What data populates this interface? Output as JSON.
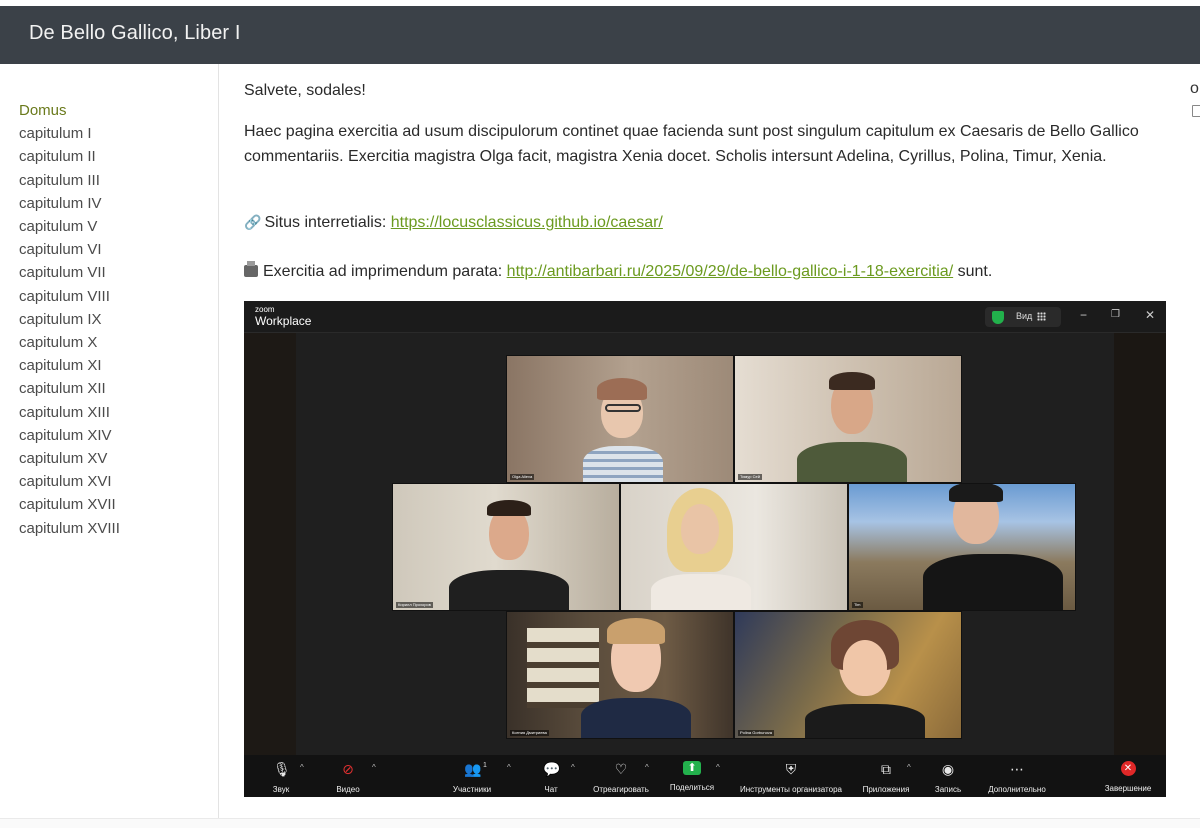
{
  "header": {
    "title": "De Bello Gallico, Liber I"
  },
  "sidebar": {
    "items": [
      {
        "label": "Domus"
      },
      {
        "label": "capitulum I"
      },
      {
        "label": "capitulum II"
      },
      {
        "label": "capitulum III"
      },
      {
        "label": "capitulum IV"
      },
      {
        "label": "capitulum V"
      },
      {
        "label": "capitulum VI"
      },
      {
        "label": "capitulum VII"
      },
      {
        "label": "capitulum VIII"
      },
      {
        "label": "capitulum IX"
      },
      {
        "label": "capitulum X"
      },
      {
        "label": "capitulum XI"
      },
      {
        "label": "capitulum XII"
      },
      {
        "label": "capitulum XIII"
      },
      {
        "label": "capitulum XIV"
      },
      {
        "label": "capitulum XV"
      },
      {
        "label": "capitulum XVI"
      },
      {
        "label": "capitulum XVII"
      },
      {
        "label": "capitulum XVIII"
      }
    ],
    "active_index": 0
  },
  "main": {
    "greeting": "Salvete, sodales!",
    "intro": "Haec pagina exercitia ad usum discipulorum continet quae facienda sunt post singulum capitulum ex Caesaris de Bello Gallico commentariis. Exercitia magistra Olga facit, magistra Xenia docet. Scholis intersunt Adelina, Cyrillus, Polina, Timur, Xenia.",
    "site_label": "Situs interretialis:",
    "site_url": "https://locusclassicus.github.io/caesar/",
    "print_label": "Exercitia ad imprimendum parata:",
    "print_url": "http://antibarbari.ru/2025/09/29/de-bello-gallico-i-1-18-exercitia/",
    "print_suffix": "sunt.",
    "right_edge_text": "o"
  },
  "zoom": {
    "logo_top": "zoom",
    "logo_bottom": "Workplace",
    "view_label": "Вид",
    "window_controls": [
      "−",
      "❐",
      "✕"
    ],
    "participants": [
      {
        "name": "Olga Alieva"
      },
      {
        "name": "Тимур Сей"
      },
      {
        "name": "Кирилл Прохоров"
      },
      {
        "name": ""
      },
      {
        "name": "Tim"
      },
      {
        "name": "Ксения Дмитриева"
      },
      {
        "name": "Polina Gorbunova"
      }
    ],
    "toolbar": {
      "audio": "Звук",
      "video": "Видео",
      "participants": "Участники",
      "participants_count": "1",
      "chat": "Чат",
      "react": "Отреагировать",
      "share": "Поделиться",
      "host_tools": "Инструменты организатора",
      "apps": "Приложения",
      "record": "Запись",
      "more": "Дополнительно",
      "end": "Завершение"
    }
  }
}
